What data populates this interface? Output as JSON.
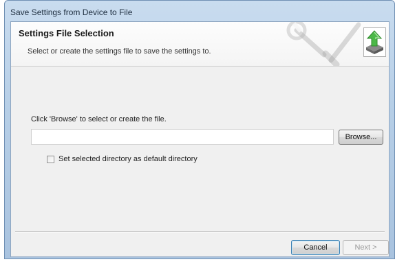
{
  "window": {
    "title": "Save Settings from Device to File"
  },
  "header": {
    "title": "Settings File Selection",
    "subtitle": "Select or create the settings file to save the settings to.",
    "decor_icon": "wrench-screwdriver-icon",
    "badge_icon": "green-up-arrow-icon"
  },
  "main": {
    "instruction": "Click 'Browse' to select or create the file.",
    "file_path": {
      "value": "",
      "placeholder": ""
    },
    "browse_label": "Browse...",
    "default_dir_checkbox": {
      "label": "Set selected directory as default directory",
      "checked": false
    }
  },
  "footer": {
    "cancel_label": "Cancel",
    "next_label": "Next >"
  },
  "colors": {
    "accent": "#3c7fb1",
    "arrow": "#4cb848",
    "frame": "#b7cfe7"
  }
}
